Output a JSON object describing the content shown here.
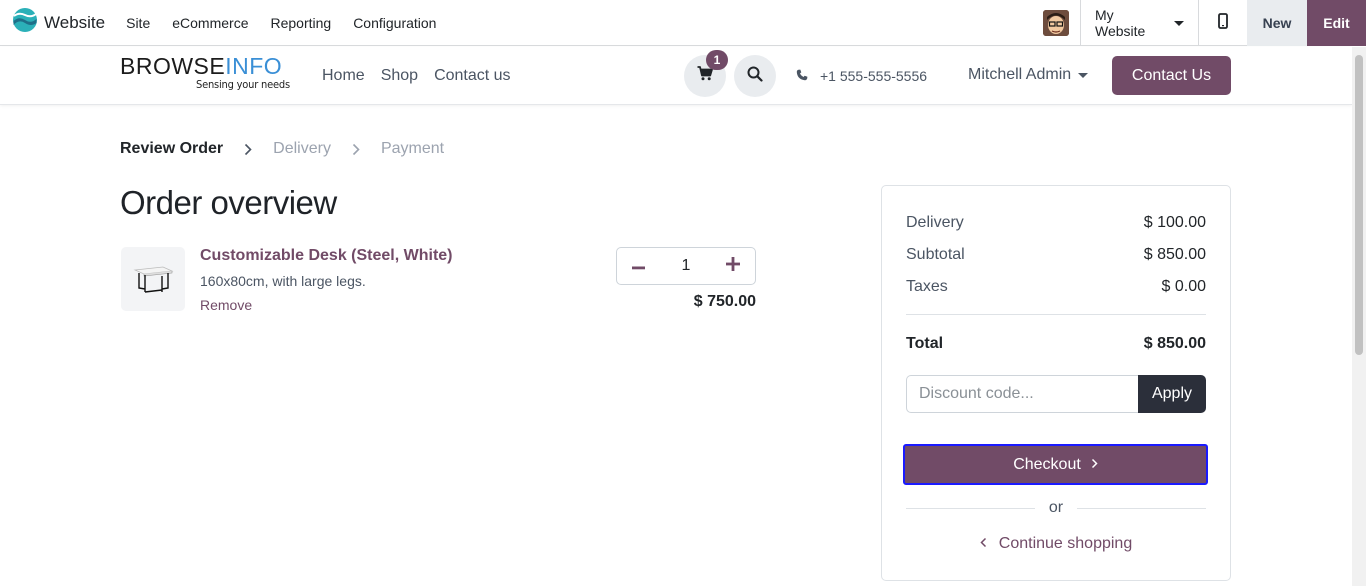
{
  "adminbar": {
    "app_name": "Website",
    "menu": [
      "Site",
      "eCommerce",
      "Reporting",
      "Configuration"
    ],
    "website_selector": "My Website",
    "new_label": "New",
    "edit_label": "Edit"
  },
  "header": {
    "brand_part1": "BROWSE",
    "brand_part2": "INFO",
    "brand_tagline": "Sensing your needs",
    "nav": [
      "Home",
      "Shop",
      "Contact us"
    ],
    "cart_count": "1",
    "phone": "+1 555-555-5556",
    "user": "Mitchell Admin",
    "contact_button": "Contact Us"
  },
  "steps": {
    "active": "Review Order",
    "step2": "Delivery",
    "step3": "Payment"
  },
  "page_title": "Order overview",
  "line_item": {
    "name": "Customizable Desk (Steel, White)",
    "description": "160x80cm, with large legs.",
    "remove": "Remove",
    "quantity": "1",
    "price": "$ 750.00"
  },
  "summary": {
    "delivery_label": "Delivery",
    "delivery_value": "$ 100.00",
    "subtotal_label": "Subtotal",
    "subtotal_value": "$ 850.00",
    "taxes_label": "Taxes",
    "taxes_value": "$ 0.00",
    "total_label": "Total",
    "total_value": "$ 850.00",
    "discount_placeholder": "Discount code...",
    "apply_label": "Apply",
    "checkout_label": "Checkout",
    "or_label": "or",
    "continue_label": "Continue shopping"
  },
  "colors": {
    "accent": "#714b67",
    "brand_info": "#3a8fd6",
    "focus_outline": "#1a1aff"
  }
}
